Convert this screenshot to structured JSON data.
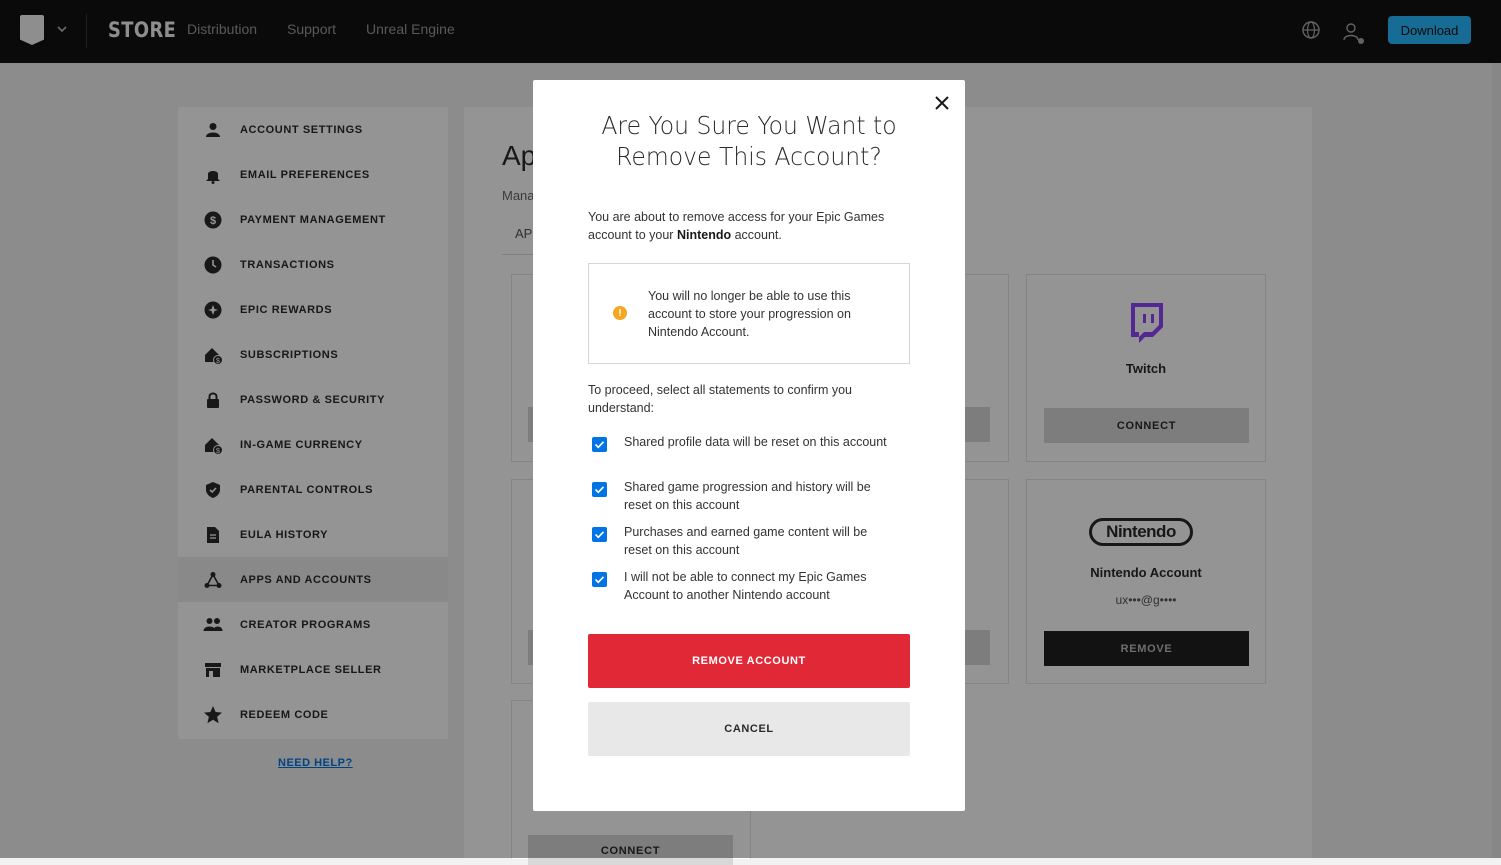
{
  "header": {
    "store_label": "STORE",
    "nav": [
      "Distribution",
      "Support",
      "Unreal Engine"
    ],
    "download_label": "Download"
  },
  "sidebar": {
    "items": [
      {
        "label": "ACCOUNT SETTINGS",
        "icon": "person-icon"
      },
      {
        "label": "EMAIL PREFERENCES",
        "icon": "bell-icon"
      },
      {
        "label": "PAYMENT MANAGEMENT",
        "icon": "dollar-icon"
      },
      {
        "label": "TRANSACTIONS",
        "icon": "clock-icon"
      },
      {
        "label": "EPIC REWARDS",
        "icon": "rewards-icon"
      },
      {
        "label": "SUBSCRIPTIONS",
        "icon": "subscriptions-icon"
      },
      {
        "label": "PASSWORD & SECURITY",
        "icon": "lock-icon"
      },
      {
        "label": "IN-GAME CURRENCY",
        "icon": "currency-icon"
      },
      {
        "label": "PARENTAL CONTROLS",
        "icon": "shield-icon"
      },
      {
        "label": "EULA HISTORY",
        "icon": "document-icon"
      },
      {
        "label": "APPS AND ACCOUNTS",
        "icon": "apps-icon"
      },
      {
        "label": "CREATOR PROGRAMS",
        "icon": "people-icon"
      },
      {
        "label": "MARKETPLACE SELLER",
        "icon": "store-icon"
      },
      {
        "label": "REDEEM CODE",
        "icon": "star-icon"
      }
    ],
    "active_index": 10,
    "need_help": "NEED HELP?"
  },
  "main": {
    "title_partial": "Ap",
    "subtitle_partial": "Mana",
    "tab_partial": "AP",
    "cards": {
      "twitch": {
        "name": "Twitch",
        "button": "CONNECT"
      },
      "nintendo": {
        "name": "Nintendo Account",
        "logo_text": "Nintendo",
        "email": "ux•••@g••••",
        "button": "REMOVE"
      },
      "bottom_button": "CONNECT"
    }
  },
  "modal": {
    "title": "Are You Sure You Want to Remove This Account?",
    "intro_before": "You are about to remove access for your Epic Games account to your ",
    "intro_bold": "Nintendo",
    "intro_after": " account.",
    "warning": "You will no longer be able to use this account to store your progression on Nintendo Account.",
    "proceed": "To proceed, select all statements to confirm you understand:",
    "statements": [
      "Shared profile data will be reset on this account",
      "Shared game progression and history will be reset on this account",
      "Purchases and earned game content will be reset on this account",
      "I will not be able to connect my Epic Games Account to another Nintendo account"
    ],
    "remove_label": "REMOVE ACCOUNT",
    "cancel_label": "CANCEL"
  },
  "colors": {
    "accent_blue": "#0074e4",
    "download_blue": "#26bbff",
    "danger_red": "#e02837",
    "warning_orange": "#f5a623"
  }
}
